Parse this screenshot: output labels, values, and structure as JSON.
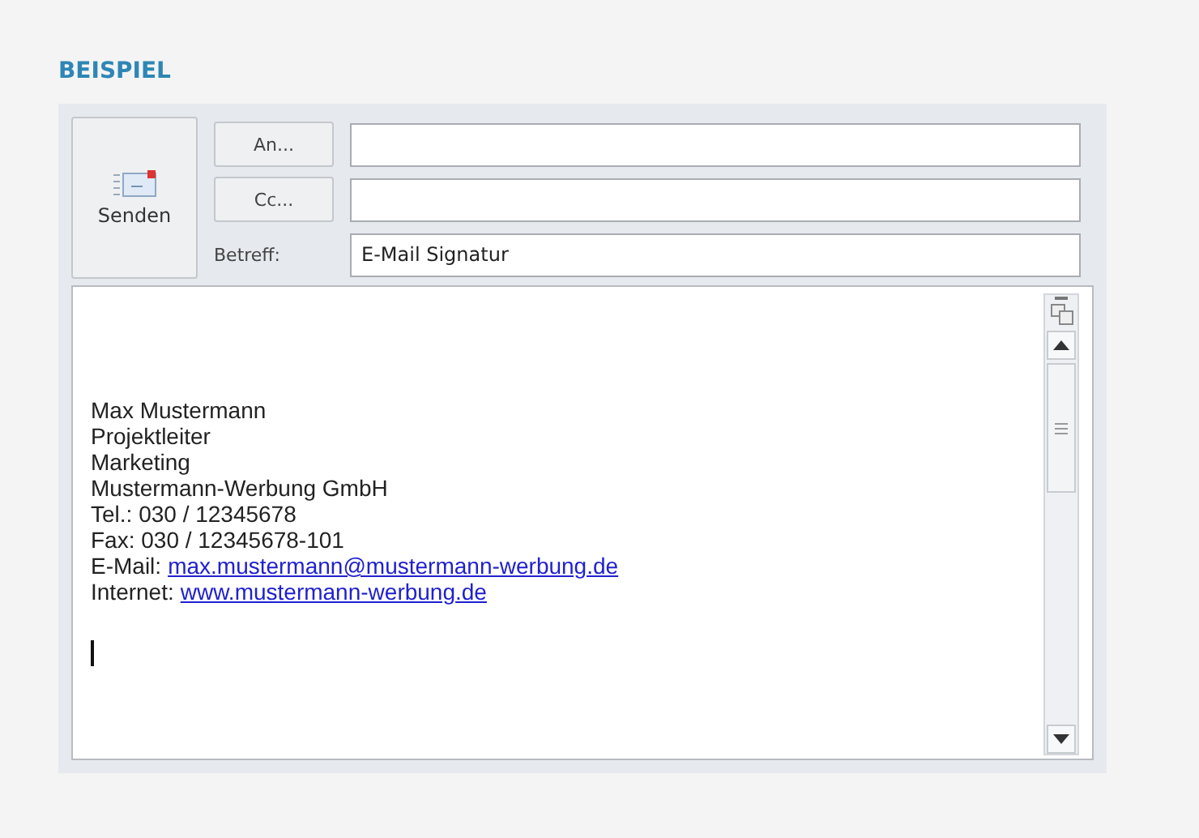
{
  "heading": "BEISPIEL",
  "send_button": {
    "label": "Senden"
  },
  "fields": [
    {
      "kind": "button",
      "label": "An..."
    },
    {
      "kind": "button",
      "label": "Cc..."
    },
    {
      "kind": "label",
      "label": "Betreff:",
      "value": "E-Mail Signatur"
    }
  ],
  "body": {
    "lines": [
      {
        "kind": "text",
        "text": "Max Mustermann"
      },
      {
        "kind": "text",
        "text": "Projektleiter"
      },
      {
        "kind": "text",
        "text": "Marketing"
      },
      {
        "kind": "text",
        "text": "Mustermann-Werbung GmbH"
      },
      {
        "kind": "text",
        "text": "Tel.: 030 / 12345678"
      },
      {
        "kind": "text",
        "text": "Fax: 030 / 12345678-101"
      },
      {
        "kind": "link",
        "label": "E-Mail:",
        "link": "max.mustermann@mustermann-werbung.de"
      },
      {
        "kind": "link",
        "label": "Internet:",
        "link": "www.mustermann-werbung.de"
      }
    ]
  }
}
